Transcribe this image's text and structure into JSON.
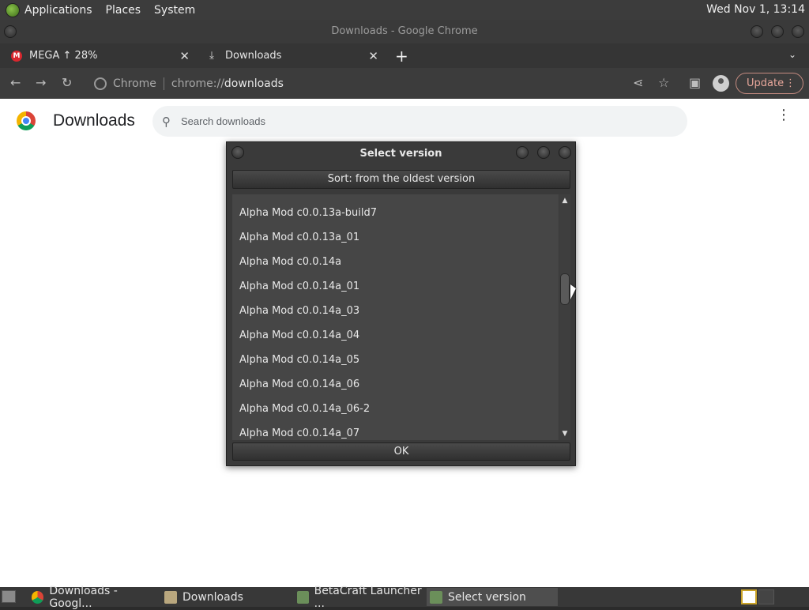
{
  "top_panel": {
    "menus": [
      "Applications",
      "Places",
      "System"
    ],
    "clock": "Wed Nov 1, 13:14"
  },
  "chrome": {
    "window_title": "Downloads - Google Chrome",
    "tabs": [
      {
        "label": "MEGA ↑ 28%",
        "icon": "mega-icon"
      },
      {
        "label": "Downloads",
        "icon": "download-icon"
      }
    ],
    "toolbar": {
      "chip": "Chrome",
      "url_scheme": "chrome://",
      "url_host": "downloads",
      "update_label": "Update"
    }
  },
  "downloads_page": {
    "title": "Downloads",
    "search_placeholder": "Search downloads"
  },
  "dialog": {
    "title": "Select version",
    "sort_label": "Sort: from the oldest version",
    "items": [
      "Alpha Mod c0.0.13a-build7",
      "Alpha Mod c0.0.13a_01",
      "Alpha Mod c0.0.14a",
      "Alpha Mod c0.0.14a_01",
      "Alpha Mod c0.0.14a_03",
      "Alpha Mod c0.0.14a_04",
      "Alpha Mod c0.0.14a_05",
      "Alpha Mod c0.0.14a_06",
      "Alpha Mod c0.0.14a_06-2",
      "Alpha Mod c0.0.14a_07"
    ],
    "ok_label": "OK"
  },
  "taskbar": {
    "tasks": [
      {
        "label": "Downloads - Googl...",
        "icon": "chrome-icon"
      },
      {
        "label": "Downloads",
        "icon": "folder-icon"
      },
      {
        "label": "BetaCraft Launcher ...",
        "icon": "betacraft-icon"
      },
      {
        "label": "Select version",
        "icon": "betacraft-icon"
      }
    ]
  }
}
